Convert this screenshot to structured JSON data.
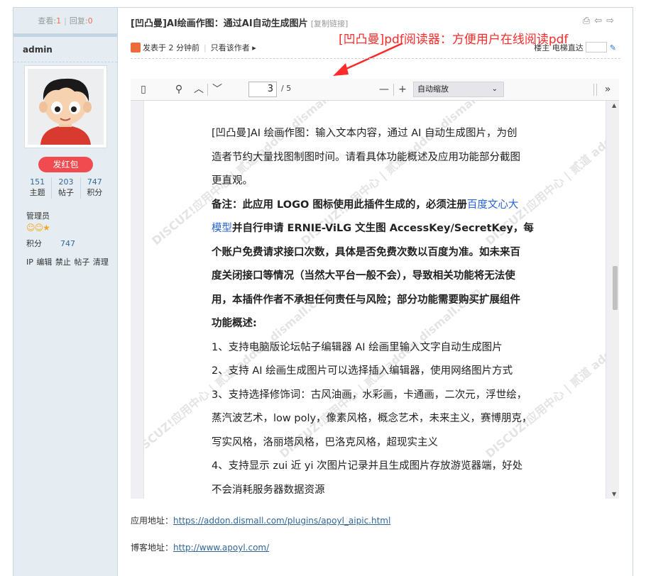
{
  "stats": {
    "views_label": "查看:",
    "views": "1",
    "replies_label": "回复:",
    "replies": "0"
  },
  "author": {
    "name": "admin",
    "redpack_label": "发红包",
    "counts": [
      {
        "value": "151",
        "label": "主题"
      },
      {
        "value": "203",
        "label": "帖子"
      },
      {
        "value": "747",
        "label": "积分"
      }
    ],
    "role": "管理员",
    "points_label": "积分",
    "points_value": "747",
    "admin_links": "IP 编辑 禁止 帖子 清理"
  },
  "thread": {
    "title": "[凹凸曼]AI绘画作图：通过AI自动生成图片",
    "copy_link": "[复制链接]",
    "annotation": "[凹凸曼]pdf阅读器：方便用户在线阅读pdf",
    "posted": "发表于 2 分钟前",
    "only_author": "只看该作者 ▸",
    "floor": "楼主",
    "jump_label": "电梯直达"
  },
  "viewer": {
    "page_current": "3",
    "page_total": "/ 5",
    "zoom": "自动缩放",
    "lines": [
      {
        "text": "[凹凸曼]AI 绘画作图：输入文本内容，通过 AI 自动生成图片，为创",
        "bold": false
      },
      {
        "text": "造者节约大量找图制图时间。请看具体功能概述及应用功能部分截图",
        "bold": false
      },
      {
        "text": "更直观。",
        "bold": false
      },
      {
        "text": "备注：此应用 LOGO 图标使用此插件生成的，必须注册",
        "bold": true,
        "link": "百度文心大"
      },
      {
        "text": "并自行申请 ERNIE-ViLG 文生图 AccessKey/SecretKey，每",
        "bold": true,
        "link_before": "模型"
      },
      {
        "text": "个账户免费请求接口次数，具体是否免费次数以百度为准。如未来百",
        "bold": true
      },
      {
        "text": "度关闭接口等情况（当然大平台一般不会），导致相关功能将无法使",
        "bold": true
      },
      {
        "text": "用，本插件作者不承担任何责任与风险；部分功能需要购买扩展组件",
        "bold": true
      },
      {
        "text": "功能概述:",
        "bold": true
      },
      {
        "text": "1、支持电脑版论坛帖子编辑器 AI 绘画里输入文字自动生成图片",
        "bold": false
      },
      {
        "text": "2、支持 AI 绘画生成图片可以选择插入编辑器，使用网络图片方式",
        "bold": false
      },
      {
        "text": "3、支持选择修饰词：古风油画，水彩画，卡通画，二次元，浮世绘，",
        "bold": false
      },
      {
        "text": "蒸汽波艺术，low poly，像素风格，概念艺术，未来主义，赛博朋克，",
        "bold": false
      },
      {
        "text": "写实风格，洛丽塔风格，巴洛克风格，超现实主义",
        "bold": false
      },
      {
        "text": "4、支持显示 zui 近 yi 次图片记录并且生成图片存放游览器端，好处",
        "bold": false
      },
      {
        "text": "不会消耗服务器数据资源",
        "bold": false
      }
    ],
    "watermark": "DISCUZ!应用中心 | 贰道 addon.dismall.com"
  },
  "links": {
    "app_label": "应用地址：",
    "app_url": "https://addon.dismall.com/plugins/apoyl_aipic.html",
    "blog_label": "博客地址：",
    "blog_url": "http://www.apoyl.com/"
  },
  "colors": {
    "accent_red": "#ff2a2a",
    "link": "#336699",
    "redpack": "#f14b4f"
  }
}
